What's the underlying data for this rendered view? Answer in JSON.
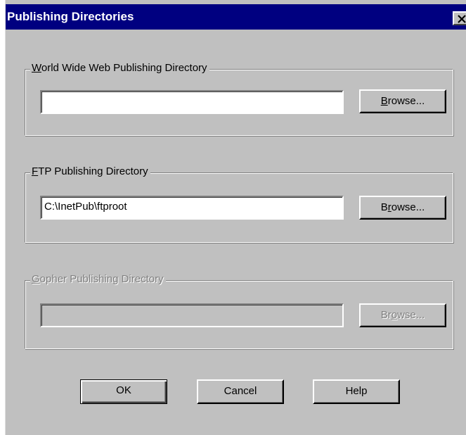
{
  "window": {
    "title": "Publishing Directories",
    "close_symbol": "✕"
  },
  "www_group": {
    "label_mnemonic": "W",
    "label_rest": "orld Wide Web Publishing Directory",
    "path_value": "",
    "browse_mnemonic": "B",
    "browse_rest": "rowse..."
  },
  "ftp_group": {
    "label_mnemonic": "F",
    "label_rest": "TP Publishing Directory",
    "path_value": "C:\\InetPub\\ftproot",
    "browse_pre": "B",
    "browse_mnemonic": "r",
    "browse_rest": "owse..."
  },
  "gopher_group": {
    "label_mnemonic": "G",
    "label_rest": "opher Publishing Directory",
    "path_value": "",
    "browse_pre": "Br",
    "browse_mnemonic": "o",
    "browse_rest": "wse...",
    "enabled": false
  },
  "footer": {
    "ok_label": "OK",
    "cancel_label": "Cancel",
    "help_label": "Help"
  },
  "icons": {
    "close": "close-icon"
  },
  "colors": {
    "titlebar": "#000080",
    "face": "#c0c0c0",
    "disabled_text": "#808080"
  }
}
